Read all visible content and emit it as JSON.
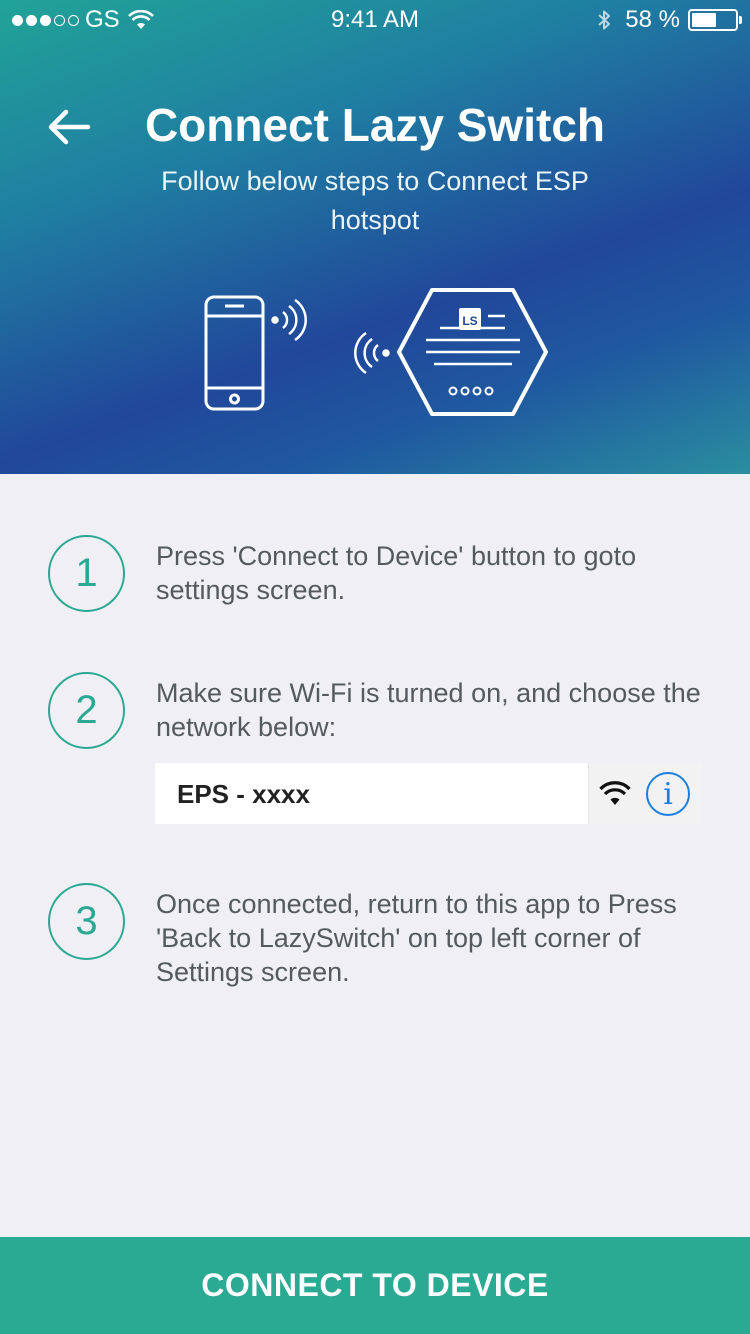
{
  "status_bar": {
    "carrier": "GS",
    "time": "9:41 AM",
    "battery_percent": "58 %",
    "battery_level": 0.58,
    "signal_dots_filled": 3,
    "signal_dots_total": 5
  },
  "header": {
    "title": "Connect Lazy Switch",
    "subtitle": "Follow below steps to Connect ESP hotspot",
    "device_logo": "LS"
  },
  "steps": [
    {
      "number": "1",
      "text": "Press 'Connect to Device' button to goto settings screen."
    },
    {
      "number": "2",
      "text": "Make sure Wi-Fi is turned on, and choose the network below:"
    },
    {
      "number": "3",
      "text": "Once connected, return to this app to Press 'Back to LazySwitch' on top left corner of Settings screen."
    }
  ],
  "network": {
    "name": "EPS - xxxx",
    "icons": [
      "wifi-icon",
      "info-icon"
    ],
    "info_glyph": "i"
  },
  "connect_button": {
    "label": "CONNECT TO DEVICE"
  },
  "colors": {
    "accent": "#2aaa92",
    "info_blue": "#1a7fe0",
    "background": "#efeff4",
    "header_gradient": [
      "#21a397",
      "#21479a"
    ]
  }
}
